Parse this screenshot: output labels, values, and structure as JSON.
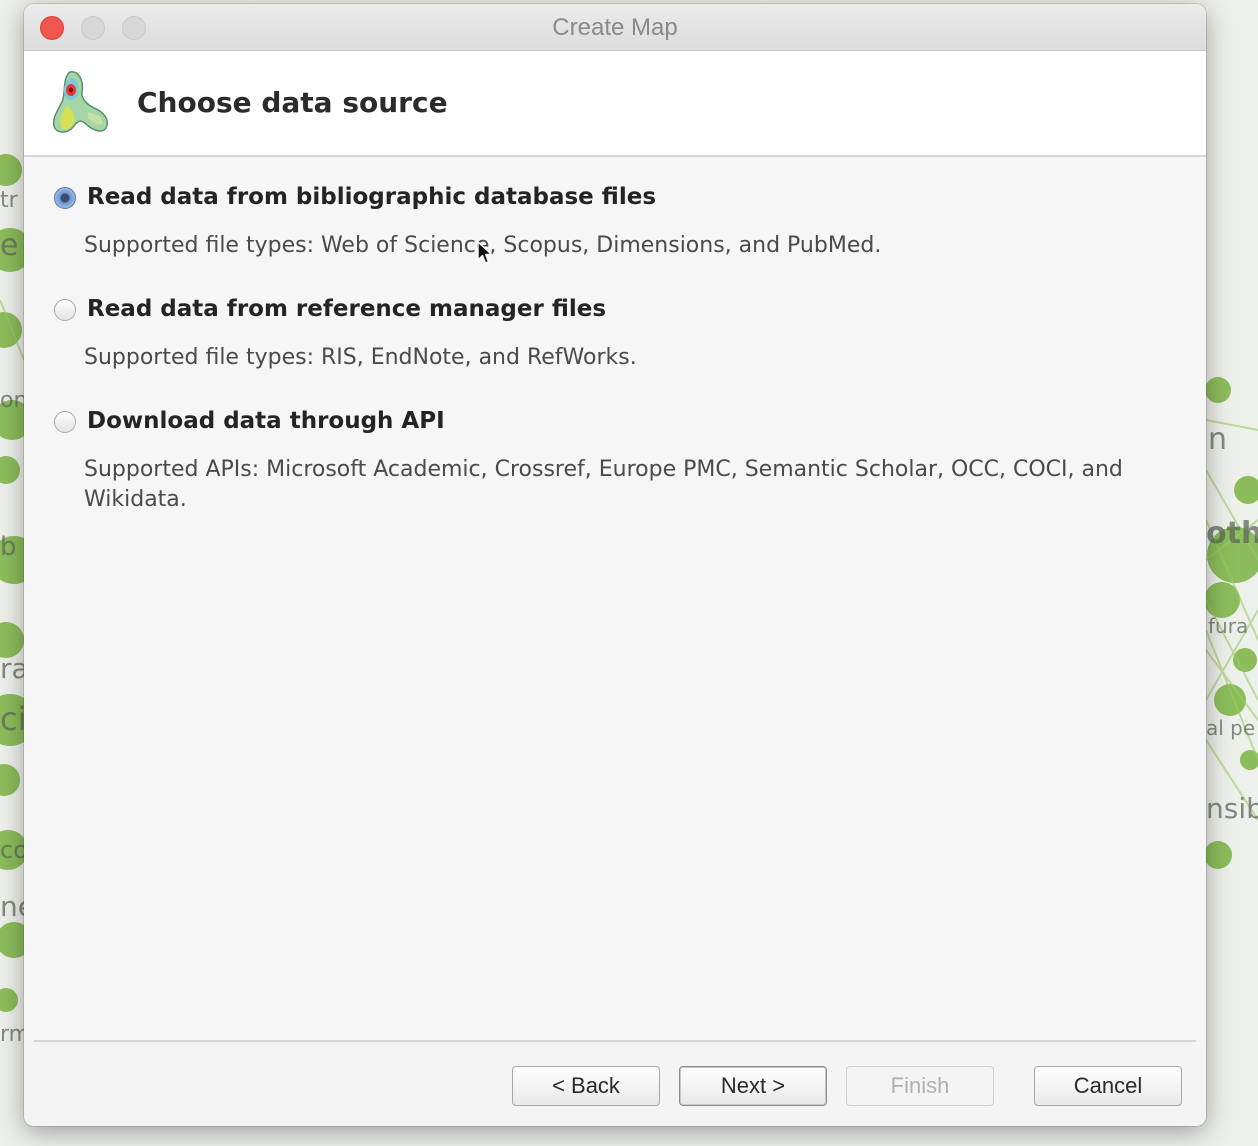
{
  "window": {
    "title": "Create Map"
  },
  "header": {
    "title": "Choose data source"
  },
  "options": [
    {
      "label": "Read data from bibliographic database files",
      "description": "Supported file types: Web of Science, Scopus, Dimensions, and PubMed.",
      "selected": true
    },
    {
      "label": "Read data from reference manager files",
      "description": "Supported file types: RIS, EndNote, and RefWorks.",
      "selected": false
    },
    {
      "label": "Download data through API",
      "description": "Supported APIs: Microsoft Academic, Crossref, Europe PMC, Semantic Scholar, OCC, COCI, and Wikidata.",
      "selected": false
    }
  ],
  "buttons": {
    "back": "< Back",
    "next": "Next >",
    "finish": "Finish",
    "cancel": "Cancel"
  },
  "background_fragments": [
    "tr",
    "e",
    "on",
    "b",
    "ra",
    "ci",
    "co",
    "ne",
    "rm",
    "n",
    "oth",
    "fura",
    "al pe",
    "nsib"
  ],
  "colors": {
    "close_button": "#f1564f",
    "radio_selected": "#6f95cf",
    "network_green": "#7cb342"
  },
  "icons": {
    "logo": "vosviewer-logo-icon",
    "cursor": "mouse-pointer-icon"
  }
}
